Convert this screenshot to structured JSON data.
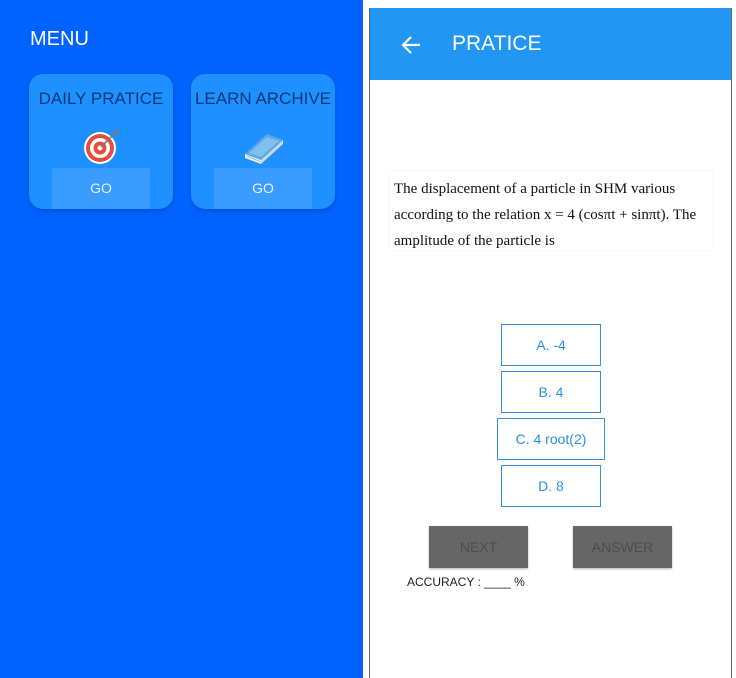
{
  "menu": {
    "title": "MENU",
    "cards": [
      {
        "title": "DAILY PRATICE",
        "icon": "target-icon",
        "go_label": "GO"
      },
      {
        "title": "LEARN ARCHIVE",
        "icon": "book-icon",
        "go_label": "GO"
      }
    ]
  },
  "practice": {
    "title": "PRATICE",
    "question": "The displacement of a particle in SHM various according to the relation x = 4 (cosπt + sinπt). The amplitude of the particle is",
    "options": [
      "A. -4",
      "B. 4",
      "C. 4 root(2)",
      "D. 8"
    ],
    "next_label": "NEXT",
    "answer_label": "ANSWER",
    "accuracy_label": "ACCURACY : ____ %"
  },
  "colors": {
    "menu_background": "#0062ff",
    "card_background": "#1e90ff",
    "app_bar": "#2196f3",
    "option_border": "#3a8fd8",
    "button_gray": "#666666"
  }
}
